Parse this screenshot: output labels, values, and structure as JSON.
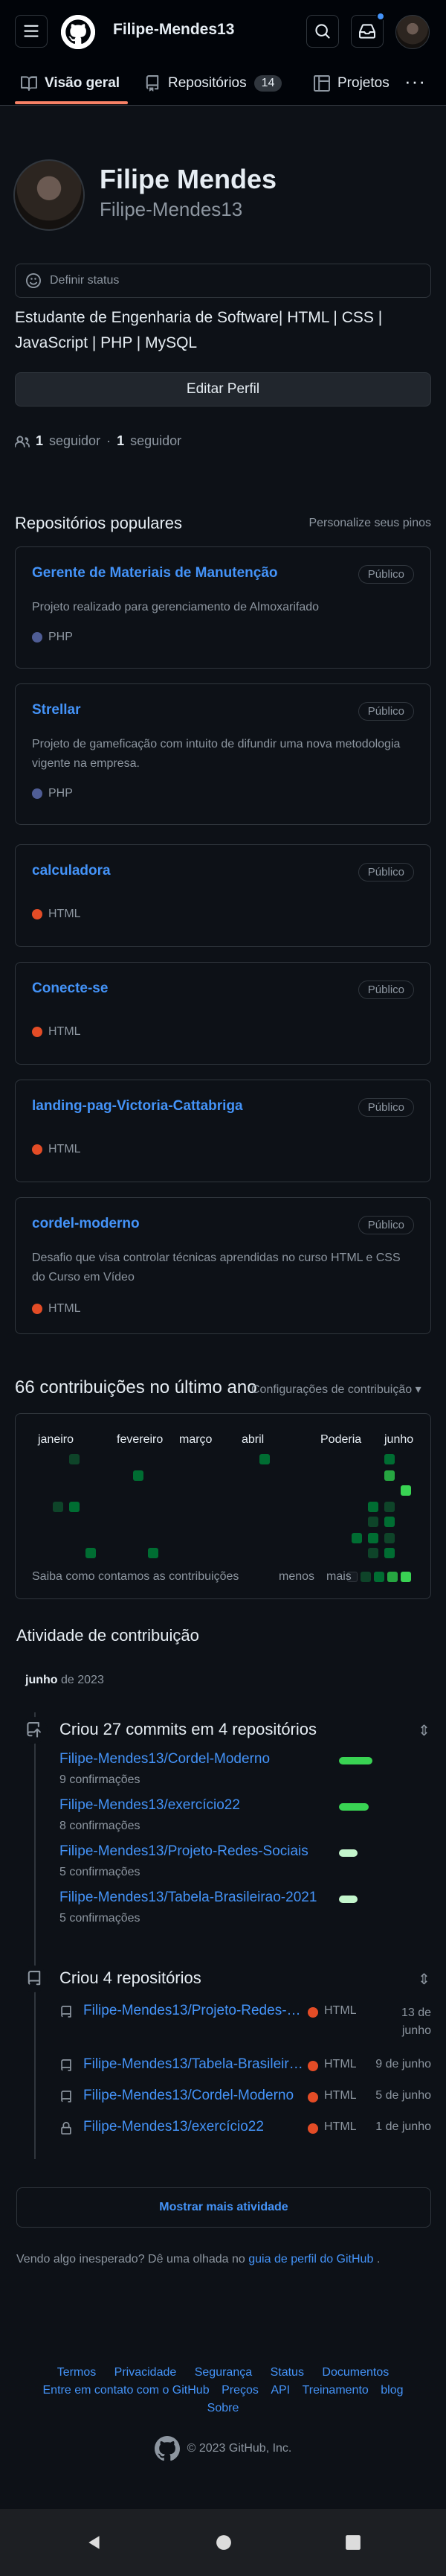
{
  "header": {
    "title": "Filipe-Mendes13"
  },
  "tabs": [
    {
      "label": "Visão geral"
    },
    {
      "label": "Repositórios",
      "count": "14"
    },
    {
      "label": "Projetos"
    }
  ],
  "profile": {
    "name": "Filipe Mendes",
    "login": "Filipe-Mendes13",
    "status_placeholder": "Definir status",
    "bio": "Estudante de Engenharia de Software| HTML | CSS | JavaScript | PHP | MySQL",
    "edit_button": "Editar Perfil",
    "followers_count": "1",
    "followers_label": "seguidor",
    "following_count": "1",
    "following_label": "seguidor"
  },
  "popular": {
    "title": "Repositórios populares",
    "customize": "Personalize seus pinos",
    "repos": [
      {
        "name": "Gerente de Materiais de Manutenção",
        "visibility": "Público",
        "description": "Projeto realizado para gerenciamento de Almoxarifado",
        "language": "PHP",
        "lang_color": "#4F5D95"
      },
      {
        "name": "Strellar",
        "visibility": "Público",
        "description": "Projeto de gameficação com intuito de difundir uma nova metodologia vigente na empresa.",
        "language": "PHP",
        "lang_color": "#4F5D95"
      },
      {
        "name": "calculadora",
        "visibility": "Público",
        "description": "",
        "language": "HTML",
        "lang_color": "#e34c26"
      },
      {
        "name": "Conecte-se",
        "visibility": "Público",
        "description": "",
        "language": "HTML",
        "lang_color": "#e34c26"
      },
      {
        "name": "landing-pag-Victoria-Cattabriga",
        "visibility": "Público",
        "description": "",
        "language": "HTML",
        "lang_color": "#e34c26"
      },
      {
        "name": "cordel-moderno",
        "visibility": "Público",
        "description": "Desafio que visa controlar técnicas aprendidas no curso HTML e CSS do Curso em Vídeo",
        "language": "HTML",
        "lang_color": "#e34c26"
      }
    ]
  },
  "contributions": {
    "title": "66 contribuições no último ano",
    "settings": "Configurações de contribuição",
    "months": [
      "janeiro",
      "fevereiro",
      "março",
      "abril",
      "Poderia",
      "junho"
    ],
    "learn": "Saiba como contamos as contribuições",
    "less": "menos",
    "more": "mais"
  },
  "activity": {
    "title": "Atividade de contribuição",
    "month": "junho",
    "year": "de 2023",
    "commits_heading": "Criou 27 commits em 4 repositórios",
    "commits": [
      {
        "repo": "Filipe-Mendes13/Cordel-Moderno",
        "count": "9 confirmações",
        "fraction": 0.9
      },
      {
        "repo": "Filipe-Mendes13/exercício22",
        "count": "8 confirmações",
        "fraction": 0.8
      },
      {
        "repo": "Filipe-Mendes13/Projeto-Redes-Sociais",
        "count": "5 confirmações",
        "fraction": 0.5
      },
      {
        "repo": "Filipe-Mendes13/Tabela-Brasileirao-2021",
        "count": "5 confirmações",
        "fraction": 0.5
      }
    ],
    "created_heading": "Criou 4 repositórios",
    "created": [
      {
        "repo": "Filipe-Mendes13/Projeto-Redes-Sociais",
        "language": "HTML",
        "date": "13 de junho"
      },
      {
        "repo": "Filipe-Mendes13/Tabela-Brasileirao-2021",
        "language": "HTML",
        "date": "9 de junho"
      },
      {
        "repo": "Filipe-Mendes13/Cordel-Moderno",
        "language": "HTML",
        "date": "5 de junho"
      },
      {
        "repo": "Filipe-Mendes13/exercício22",
        "language": "HTML",
        "date": "1 de junho"
      }
    ],
    "show_more": "Mostrar mais atividade",
    "unexpected_prefix": "Vendo algo inesperado? Dê uma olhada no",
    "unexpected_link": "guia de perfil do GitHub",
    "unexpected_suffix": "."
  },
  "footer": {
    "links_row1": [
      "Termos",
      "Privacidade",
      "Segurança",
      "Status",
      "Documentos"
    ],
    "links_row2": [
      "Entre em contato com o GitHub",
      "Preços",
      "API",
      "Treinamento",
      "blog"
    ],
    "links_row3": [
      "Sobre"
    ],
    "copyright": "© 2023 GitHub, Inc."
  },
  "colors": {
    "accent": "#4493f8",
    "tab_underline": "#f78166",
    "html": "#e34c26",
    "php": "#4F5D95"
  },
  "icons": [
    "menu-icon",
    "github-logo-icon",
    "search-icon",
    "inbox-icon",
    "book-icon",
    "repo-icon",
    "project-icon",
    "kebab-icon",
    "smiley-icon",
    "people-icon",
    "commit-icon",
    "repo-push-icon",
    "lock-icon",
    "fold-icon",
    "back-icon",
    "home-icon",
    "recents-icon"
  ]
}
